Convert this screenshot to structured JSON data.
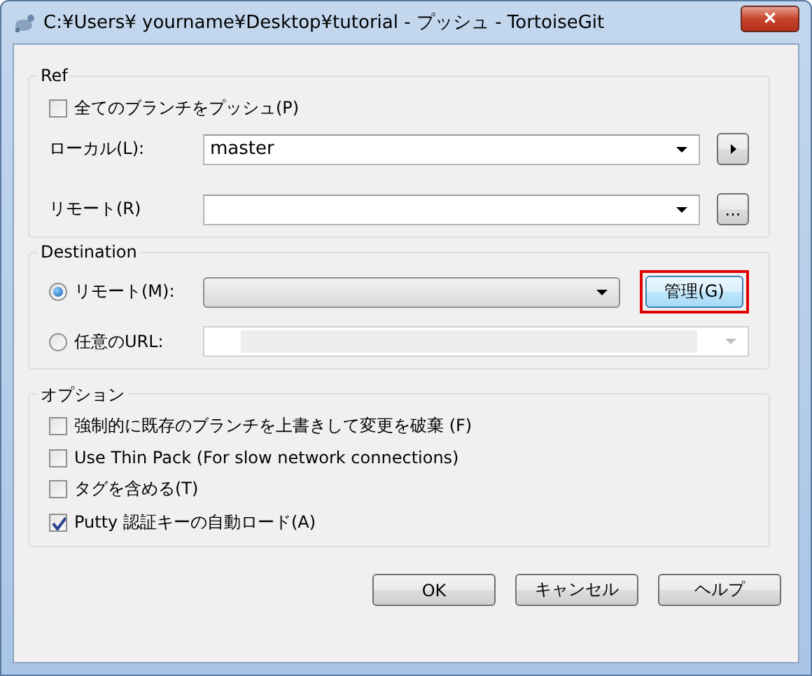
{
  "window": {
    "title": "C:¥Users¥ yourname¥Desktop¥tutorial - プッシュ - TortoiseGit",
    "close": "✕"
  },
  "ref": {
    "title": "Ref",
    "push_all": {
      "label": "全てのブランチをプッシュ(P)",
      "checked": false
    },
    "local": {
      "label": "ローカル(L):",
      "value": "master"
    },
    "remote": {
      "label": "リモート(R)",
      "button": "..."
    }
  },
  "destination": {
    "title": "Destination",
    "options": [
      {
        "label": "リモート(M):",
        "selected": true
      },
      {
        "label": "任意のURL:",
        "selected": false
      }
    ],
    "manage_button": {
      "label": "管理(G)",
      "highlighted": true
    }
  },
  "options": {
    "title": "オプション",
    "items": [
      {
        "label": "強制的に既存のブランチを上書きして変更を破棄 (F)",
        "checked": false
      },
      {
        "label": "Use Thin Pack (For slow network connections)",
        "checked": false
      },
      {
        "label": "タグを含める(T)",
        "checked": false
      },
      {
        "label": "Putty 認証キーの自動ロード(A)",
        "checked": true
      }
    ]
  },
  "buttons": [
    "OK",
    "キャンセル",
    "ヘルプ"
  ]
}
